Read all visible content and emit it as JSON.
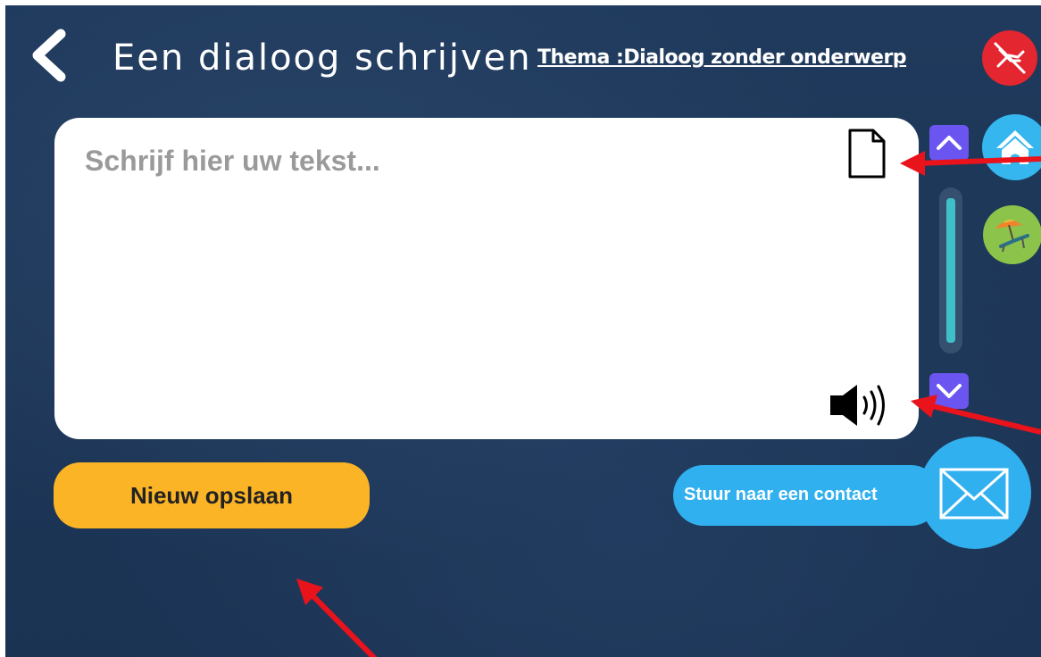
{
  "header": {
    "title": "Een dialoog schrijven",
    "theme": "Thema :Dialoog zonder onderwerp"
  },
  "editor": {
    "placeholder": "Schrijf hier uw tekst..."
  },
  "buttons": {
    "save_label": "Nieuw opslaan",
    "send_label": "Stuur naar een contact"
  },
  "icons": {
    "back": "back-chevron-icon",
    "top_right": "hands-crossed-icon",
    "home": "home-icon",
    "leisure": "beach-chair-icon",
    "document": "document-icon",
    "speaker": "speaker-icon",
    "mail": "envelope-icon",
    "scroll_up": "chevron-up-icon",
    "scroll_down": "chevron-down-icon"
  },
  "colors": {
    "background": "#1f3a5c",
    "save_button": "#fbb426",
    "send_button": "#31b0ef",
    "scroll_button": "#6b55f0",
    "scroll_thumb": "#3fc0c8",
    "red_button": "#e3262f",
    "home_button": "#35b6ef",
    "green_button": "#8cc34a",
    "annotation_arrow": "#e8131b"
  }
}
